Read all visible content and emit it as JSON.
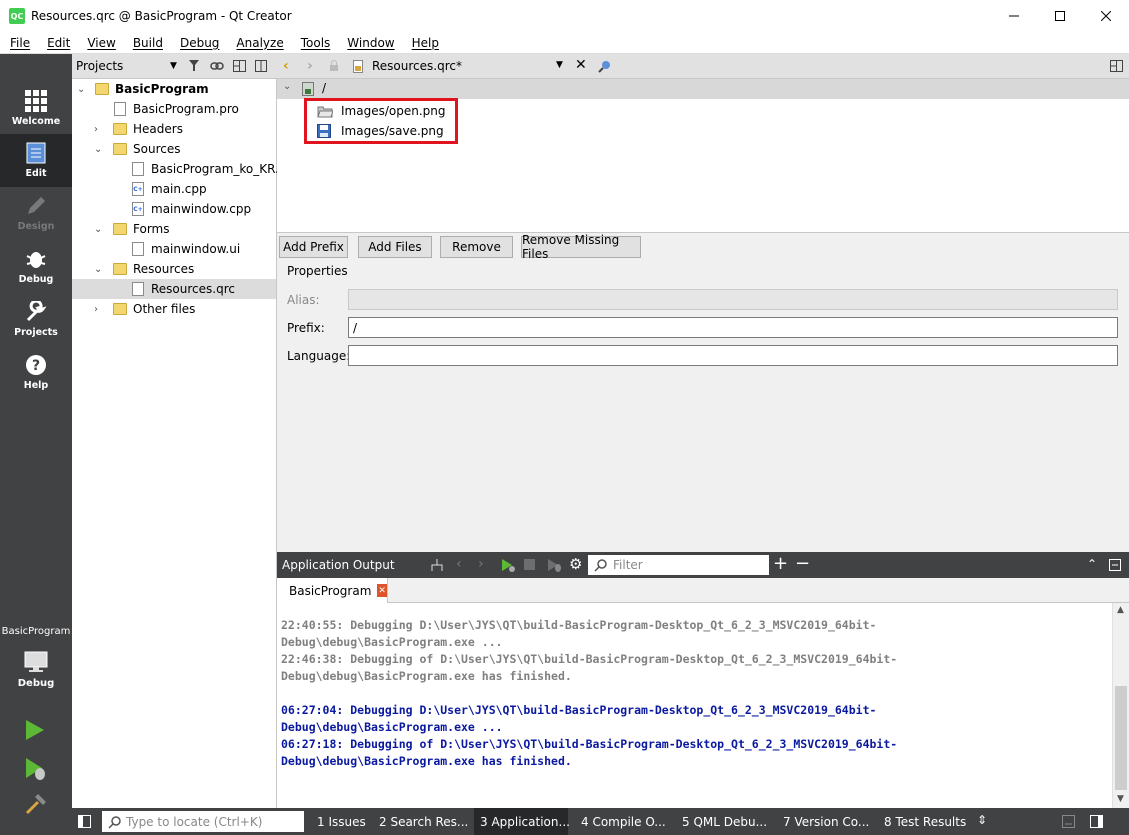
{
  "window": {
    "title": "Resources.qrc @ BasicProgram - Qt Creator",
    "logo_text": "QC"
  },
  "menu": [
    "File",
    "Edit",
    "View",
    "Build",
    "Debug",
    "Analyze",
    "Tools",
    "Window",
    "Help"
  ],
  "modes": [
    {
      "label": "Welcome",
      "icon": "grid-icon",
      "state": "normal"
    },
    {
      "label": "Edit",
      "icon": "document-icon",
      "state": "active"
    },
    {
      "label": "Design",
      "icon": "pencil-icon",
      "state": "disabled"
    },
    {
      "label": "Debug",
      "icon": "bug-icon",
      "state": "normal"
    },
    {
      "label": "Projects",
      "icon": "wrench-icon",
      "state": "normal"
    },
    {
      "label": "Help",
      "icon": "help-icon",
      "state": "normal"
    }
  ],
  "kit": {
    "project": "BasicProgram",
    "config": "Debug"
  },
  "projects_pane": {
    "title": "Projects",
    "tree": [
      {
        "label": "BasicProgram",
        "level": 0,
        "expanded": true,
        "bold": true
      },
      {
        "label": "BasicProgram.pro",
        "level": 1
      },
      {
        "label": "Headers",
        "level": 1,
        "expanded": false
      },
      {
        "label": "Sources",
        "level": 1,
        "expanded": true
      },
      {
        "label": "BasicProgram_ko_KR.ts",
        "level": 2
      },
      {
        "label": "main.cpp",
        "level": 2
      },
      {
        "label": "mainwindow.cpp",
        "level": 2
      },
      {
        "label": "Forms",
        "level": 1,
        "expanded": true
      },
      {
        "label": "mainwindow.ui",
        "level": 2
      },
      {
        "label": "Resources",
        "level": 1,
        "expanded": true
      },
      {
        "label": "Resources.qrc",
        "level": 2,
        "selected": true
      },
      {
        "label": "Other files",
        "level": 1,
        "expanded": false
      }
    ]
  },
  "editor": {
    "file_tab": "Resources.qrc*",
    "root_prefix": "/",
    "files": [
      "Images/open.png",
      "Images/save.png"
    ],
    "highlight_color": "#e0141e",
    "buttons": [
      "Add Prefix",
      "Add Files",
      "Remove",
      "Remove Missing Files"
    ],
    "properties": {
      "title": "Properties",
      "alias_label": "Alias:",
      "alias_value": "",
      "prefix_label": "Prefix:",
      "prefix_value": "/",
      "language_label": "Language:",
      "language_value": ""
    }
  },
  "output": {
    "title": "Application Output",
    "filter_placeholder": "Filter",
    "tab": "BasicProgram",
    "lines": [
      {
        "text": "22:40:55: Debugging D:\\User\\JYS\\QT\\build-BasicProgram-Desktop_Qt_6_2_3_MSVC2019_64bit-",
        "style": "gray"
      },
      {
        "text": "Debug\\debug\\BasicProgram.exe ...",
        "style": "gray"
      },
      {
        "text": "22:46:38: Debugging of D:\\User\\JYS\\QT\\build-BasicProgram-Desktop_Qt_6_2_3_MSVC2019_64bit-",
        "style": "gray"
      },
      {
        "text": "Debug\\debug\\BasicProgram.exe has finished.",
        "style": "gray"
      },
      {
        "text": "",
        "style": "gray"
      },
      {
        "text": "06:27:04: Debugging D:\\User\\JYS\\QT\\build-BasicProgram-Desktop_Qt_6_2_3_MSVC2019_64bit-",
        "style": "blue"
      },
      {
        "text": "Debug\\debug\\BasicProgram.exe ...",
        "style": "blue"
      },
      {
        "text": "06:27:18: Debugging of D:\\User\\JYS\\QT\\build-BasicProgram-Desktop_Qt_6_2_3_MSVC2019_64bit-",
        "style": "blue"
      },
      {
        "text": "Debug\\debug\\BasicProgram.exe has finished.",
        "style": "blue"
      }
    ]
  },
  "bottom": {
    "locator_placeholder": "Type to locate (Ctrl+K)",
    "tabs": [
      "1  Issues",
      "2  Search Res...",
      "3  Application...",
      "4  Compile O...",
      "5  QML Debu...",
      "7  Version Co...",
      "8  Test Results"
    ]
  }
}
